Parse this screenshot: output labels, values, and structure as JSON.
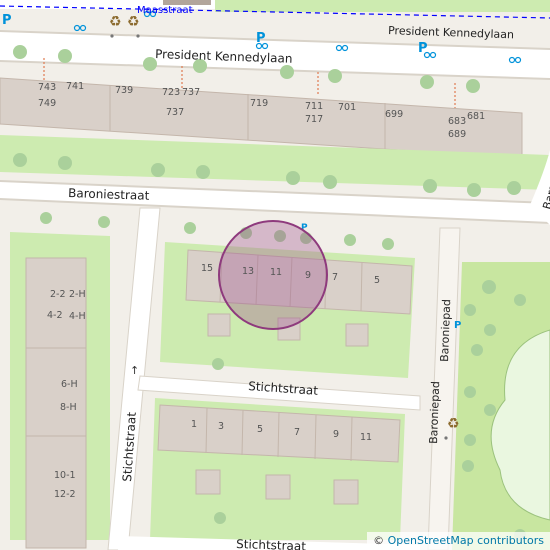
{
  "colors": {
    "background": "#f2efe9",
    "road": "#ffffff",
    "road_casing": "#d9d3c9",
    "grass": "#cdebb0",
    "park": "#c8e6a0",
    "building": "#d9d0c9",
    "building_edge": "#c4b6ab",
    "tree": "#aad09b",
    "parking_blue": "#0092da",
    "bike_blue": "#0092da",
    "recycling": "#8c6b2f",
    "highlight_fill": "#a0538f",
    "highlight_stroke": "#8e3a7d",
    "cycle_path": "#0000ff",
    "water": "#aad3df"
  },
  "streets": [
    {
      "id": "maasstraat",
      "label": "Maasstraat"
    },
    {
      "id": "kennedy-west",
      "label": "President Kennedylaan"
    },
    {
      "id": "kennedy-east",
      "label": "President Kennedylaan"
    },
    {
      "id": "baroniestraat-west",
      "label": "Baroniestraat"
    },
    {
      "id": "baroniestraat-east",
      "label": "Baroniestraat"
    },
    {
      "id": "stichtstraat-mid",
      "label": "Stichtstraat"
    },
    {
      "id": "stichtstraat-bottom",
      "label": "Stichtstraat"
    },
    {
      "id": "stichtstraat-vertical",
      "label": "Stichtstraat"
    },
    {
      "id": "baroniepad-upper",
      "label": "Baroniepad"
    },
    {
      "id": "baroniepad-lower",
      "label": "Baroniepad"
    }
  ],
  "house_numbers": [
    {
      "id": "hn-743",
      "label": "743"
    },
    {
      "id": "hn-741",
      "label": "741"
    },
    {
      "id": "hn-749",
      "label": "749"
    },
    {
      "id": "hn-739",
      "label": "739"
    },
    {
      "id": "hn-723",
      "label": "723"
    },
    {
      "id": "hn-737a",
      "label": "737"
    },
    {
      "id": "hn-737b",
      "label": "737"
    },
    {
      "id": "hn-719",
      "label": "719"
    },
    {
      "id": "hn-711",
      "label": "711"
    },
    {
      "id": "hn-717",
      "label": "717"
    },
    {
      "id": "hn-701",
      "label": "701"
    },
    {
      "id": "hn-699",
      "label": "699"
    },
    {
      "id": "hn-683",
      "label": "683"
    },
    {
      "id": "hn-681",
      "label": "681"
    },
    {
      "id": "hn-689",
      "label": "689"
    },
    {
      "id": "hn-15",
      "label": "15"
    },
    {
      "id": "hn-13",
      "label": "13"
    },
    {
      "id": "hn-11a",
      "label": "11"
    },
    {
      "id": "hn-9a",
      "label": "9"
    },
    {
      "id": "hn-7a",
      "label": "7"
    },
    {
      "id": "hn-5a",
      "label": "5"
    },
    {
      "id": "hn-2-2",
      "label": "2-2"
    },
    {
      "id": "hn-2-h",
      "label": "2-H"
    },
    {
      "id": "hn-4-2",
      "label": "4-2"
    },
    {
      "id": "hn-4-h",
      "label": "4-H"
    },
    {
      "id": "hn-6-h",
      "label": "6-H"
    },
    {
      "id": "hn-8-h",
      "label": "8-H"
    },
    {
      "id": "hn-10-1",
      "label": "10-1"
    },
    {
      "id": "hn-12-2",
      "label": "12-2"
    },
    {
      "id": "hn-1",
      "label": "1"
    },
    {
      "id": "hn-3",
      "label": "3"
    },
    {
      "id": "hn-5b",
      "label": "5"
    },
    {
      "id": "hn-7b",
      "label": "7"
    },
    {
      "id": "hn-9b",
      "label": "9"
    },
    {
      "id": "hn-11b",
      "label": "11"
    }
  ],
  "poi": {
    "parking_label": "P",
    "oneway_arrow": "↑"
  },
  "attribution": {
    "copyright": "© ",
    "link_text": "OpenStreetMap contributors"
  }
}
